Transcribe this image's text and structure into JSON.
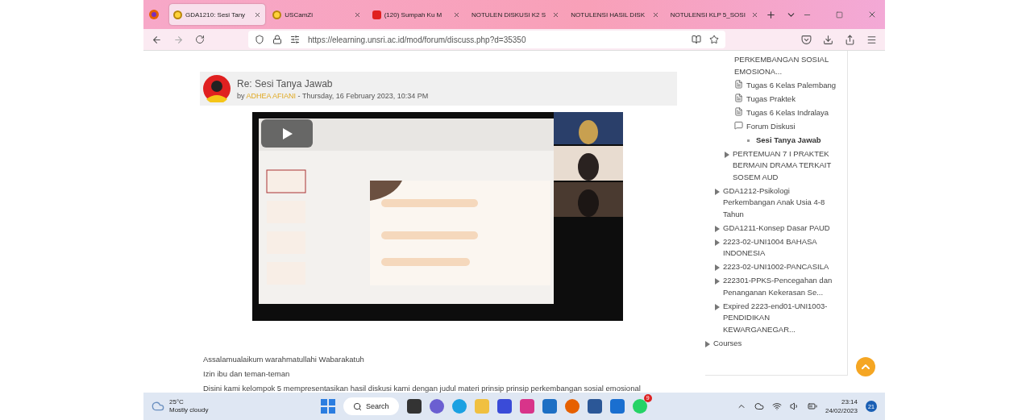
{
  "browser": {
    "tabs": [
      {
        "label": "GDA1210: Sesi Tany",
        "selected": true,
        "kind": "moodle"
      },
      {
        "label": "USCamZi",
        "selected": false,
        "kind": "moodle"
      },
      {
        "label": "(120) Sumpah Ku M",
        "selected": false,
        "kind": "video"
      },
      {
        "label": "NOTULEN DISKUSI K2 S",
        "selected": false,
        "kind": "plain"
      },
      {
        "label": "NOTULENSI HASIL DISK",
        "selected": false,
        "kind": "plain"
      },
      {
        "label": "NOTULENSI KLP 5_SOSI",
        "selected": false,
        "kind": "plain"
      }
    ],
    "url": "https://elearning.unsri.ac.id/mod/forum/discuss.php?d=35350"
  },
  "post": {
    "title": "Re: Sesi Tanya Jawab",
    "by": "by",
    "author": "ADHEA AFIANI",
    "date": "- Thursday, 16 February 2023, 10:34 PM",
    "paragraphs": [
      "Assalamualaikum warahmatullahi Wabarakatuh",
      "Izin ibu dan teman-teman",
      "Disini kami kelompok 5 mempresentasikan hasil diskusi kami dengan judul materi prinsip prinsip perkembangan sosial emosional"
    ]
  },
  "sidebar": {
    "items": [
      {
        "children": [
          {
            "children": [
              {
                "children": [
                  {
                    "kind": "text",
                    "label": "PERKEMBANGAN SOSIAL EMOSIONA..."
                  },
                  {
                    "kind": "file",
                    "label": "Tugas 6 Kelas Palembang"
                  },
                  {
                    "kind": "file",
                    "label": "Tugas Praktek"
                  },
                  {
                    "kind": "file",
                    "label": "Tugas 6 Kelas Indralaya"
                  },
                  {
                    "kind": "forum",
                    "label": "Forum Diskusi",
                    "children": [
                      {
                        "kind": "bullet",
                        "label": "Sesi Tanya Jawab",
                        "selected": true
                      }
                    ]
                  }
                ]
              },
              {
                "kind": "section",
                "label": "PERTEMUAN 7 I PRAKTEK BERMAIN DRAMA TERKAIT SOSEM AUD"
              }
            ]
          },
          {
            "kind": "section",
            "label": "GDA1212-Psikologi Perkembangan Anak Usia 4-8 Tahun"
          },
          {
            "kind": "section",
            "label": "GDA1211-Konsep Dasar PAUD"
          },
          {
            "kind": "section",
            "label": "2223-02-UNI1004 BAHASA INDONESIA"
          },
          {
            "kind": "section",
            "label": "2223-02-UNI1002-PANCASILA"
          },
          {
            "kind": "section",
            "label": "222301-PPKS-Pencegahan dan Penanganan Kekerasan Se..."
          },
          {
            "kind": "section",
            "label": "Expired 2223-end01-UNI1003-PENDIDIKAN KEWARGANEGAR..."
          }
        ]
      },
      {
        "kind": "section",
        "label": "Courses"
      }
    ]
  },
  "taskbar": {
    "temperature": "25°C",
    "weather": "Mostly cloudy",
    "search": "Search",
    "whatsapp_badge": "9",
    "time": "23:14",
    "date": "24/02/2023",
    "notifications": "21"
  }
}
